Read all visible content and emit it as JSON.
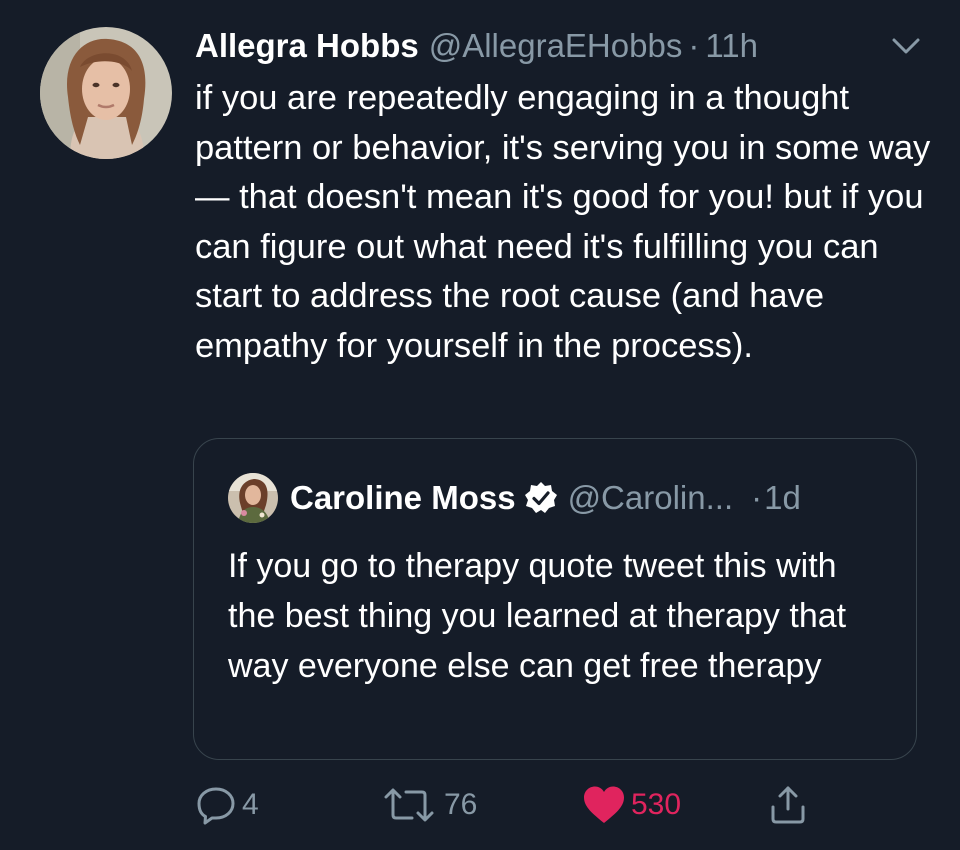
{
  "tweet": {
    "author_name": "Allegra Hobbs",
    "author_handle": "@AllegraEHobbs",
    "separator": "·",
    "time": "11h",
    "text": "if you are repeatedly engaging in a thought pattern or behavior, it's serving you in some way — that doesn't mean it's good for you! but if you can figure out what need it's fulfilling you can start to address the root cause (and have empathy for yourself in the process).",
    "icons": {
      "menu": "chevron-down-icon"
    }
  },
  "quoted_tweet": {
    "author_name": "Caroline Moss",
    "verified": true,
    "author_handle": "@Carolin...",
    "separator": "·",
    "time": "1d",
    "text": "If you go to therapy quote tweet this with the best thing you learned at therapy that way everyone else can get free therapy"
  },
  "actions": {
    "replies": "4",
    "retweets": "76",
    "likes": "530",
    "liked": true,
    "icons": {
      "reply": "reply-icon",
      "retweet": "retweet-icon",
      "like": "heart-icon",
      "share": "share-icon"
    }
  },
  "colors": {
    "background": "#151c28",
    "text": "#ffffff",
    "secondary_text": "#8899a6",
    "border": "#38444d",
    "like": "#e0245e"
  }
}
